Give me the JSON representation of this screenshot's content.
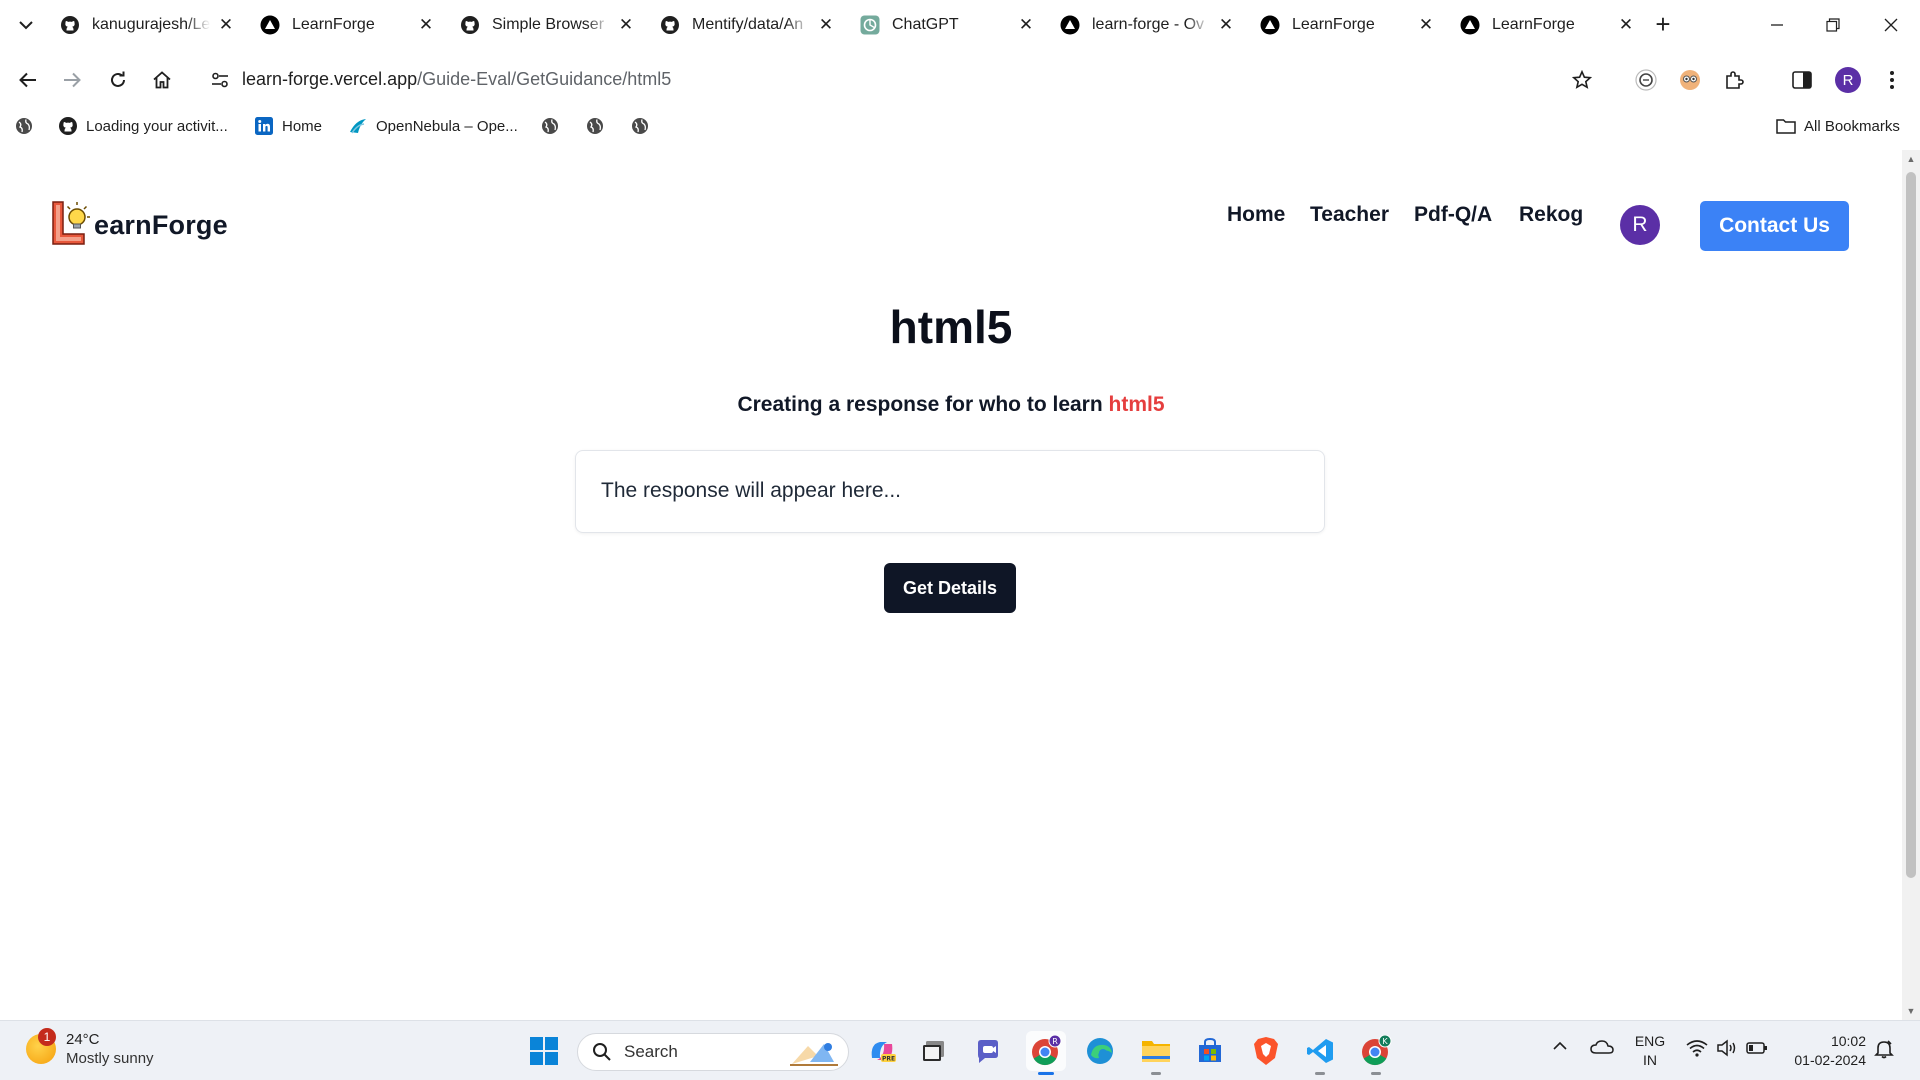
{
  "browser": {
    "tabs": [
      {
        "title": "kanugurajesh/Le",
        "icon": "github-icon",
        "active": false
      },
      {
        "title": "LearnForge",
        "icon": "vercel-icon",
        "active": false
      },
      {
        "title": "Simple Browser",
        "icon": "github-icon",
        "active": false
      },
      {
        "title": "Mentify/data/An",
        "icon": "github-icon",
        "active": false
      },
      {
        "title": "ChatGPT",
        "icon": "chatgpt-icon",
        "active": false
      },
      {
        "title": "learn-forge - Ov",
        "icon": "vercel-icon",
        "active": false
      },
      {
        "title": "LearnForge",
        "icon": "vercel-icon",
        "active": false
      },
      {
        "title": "LearnForge",
        "icon": "vercel-icon",
        "active": true
      }
    ],
    "url": {
      "host": "learn-forge.vercel.app",
      "path": "/Guide-Eval/GetGuidance/html5"
    },
    "profile_initial": "R",
    "bookmarks": [
      {
        "label": "Loading your activit...",
        "icon": "github-icon"
      },
      {
        "label": "Home",
        "icon": "linkedin-icon"
      },
      {
        "label": "OpenNebula – Ope...",
        "icon": "opennebula-icon"
      },
      {
        "label": "",
        "icon": "globe-icon"
      },
      {
        "label": "",
        "icon": "globe-icon"
      },
      {
        "label": "",
        "icon": "globe-icon"
      }
    ],
    "all_bookmarks": "All Bookmarks"
  },
  "site": {
    "brand": "earnForge",
    "nav": [
      "Home",
      "Teacher",
      "Pdf-Q/A",
      "Rekog"
    ],
    "user_initial": "R",
    "contact_label": "Contact Us"
  },
  "main": {
    "heading": "html5",
    "subheading_prefix": "Creating a response for who to learn ",
    "subheading_topic": "html5",
    "response_placeholder": "The response will appear here...",
    "button_label": "Get Details"
  },
  "colors": {
    "accent_blue": "#3b82f6",
    "topic_red": "#e53e3e",
    "button_dark": "#0f1626",
    "avatar_purple": "#5b2fa6"
  },
  "taskbar": {
    "weather": {
      "temp": "24°C",
      "condition": "Mostly sunny",
      "badge": "1"
    },
    "search_label": "Search",
    "lang": [
      "ENG",
      "IN"
    ],
    "time": "10:02",
    "date": "01-02-2024"
  }
}
